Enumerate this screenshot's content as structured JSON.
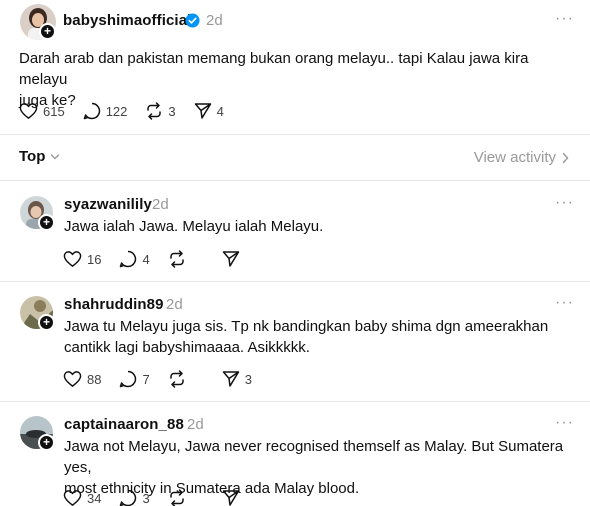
{
  "post": {
    "username": "babyshimaofficial",
    "time": "2d",
    "more": "···",
    "text_line1": "Darah arab dan pakistan memang bukan orang melayu.. tapi Kalau jawa kira melayu",
    "text_line2": "juga ke?",
    "likes": "615",
    "comments": "122",
    "reposts": "3",
    "shares": "4"
  },
  "sort": {
    "label": "Top",
    "view_activity": "View activity"
  },
  "replies": [
    {
      "username": "syazwanilily",
      "time": "2d",
      "more": "···",
      "text_line1": "Jawa ialah Jawa. Melayu ialah Melayu.",
      "text_line2": "",
      "likes": "16",
      "comments": "4",
      "reposts": "",
      "shares": ""
    },
    {
      "username": "shahruddin89",
      "time": "2d",
      "more": "···",
      "text_line1": "Jawa tu Melayu juga sis. Tp nk bandingkan baby shima dgn ameerakhan",
      "text_line2": "cantikk lagi babyshimaaaa. Asikkkkk.",
      "likes": "88",
      "comments": "7",
      "reposts": "",
      "shares": "3"
    },
    {
      "username": "captainaaron_88",
      "time": "2d",
      "more": "···",
      "text_line1": "Jawa not Melayu, Jawa never recognised themself as Malay. But Sumatera yes,",
      "text_line2": "most ethnicity in Sumatera ada Malay blood.",
      "likes": "34",
      "comments": "3",
      "reposts": "",
      "shares": ""
    }
  ]
}
